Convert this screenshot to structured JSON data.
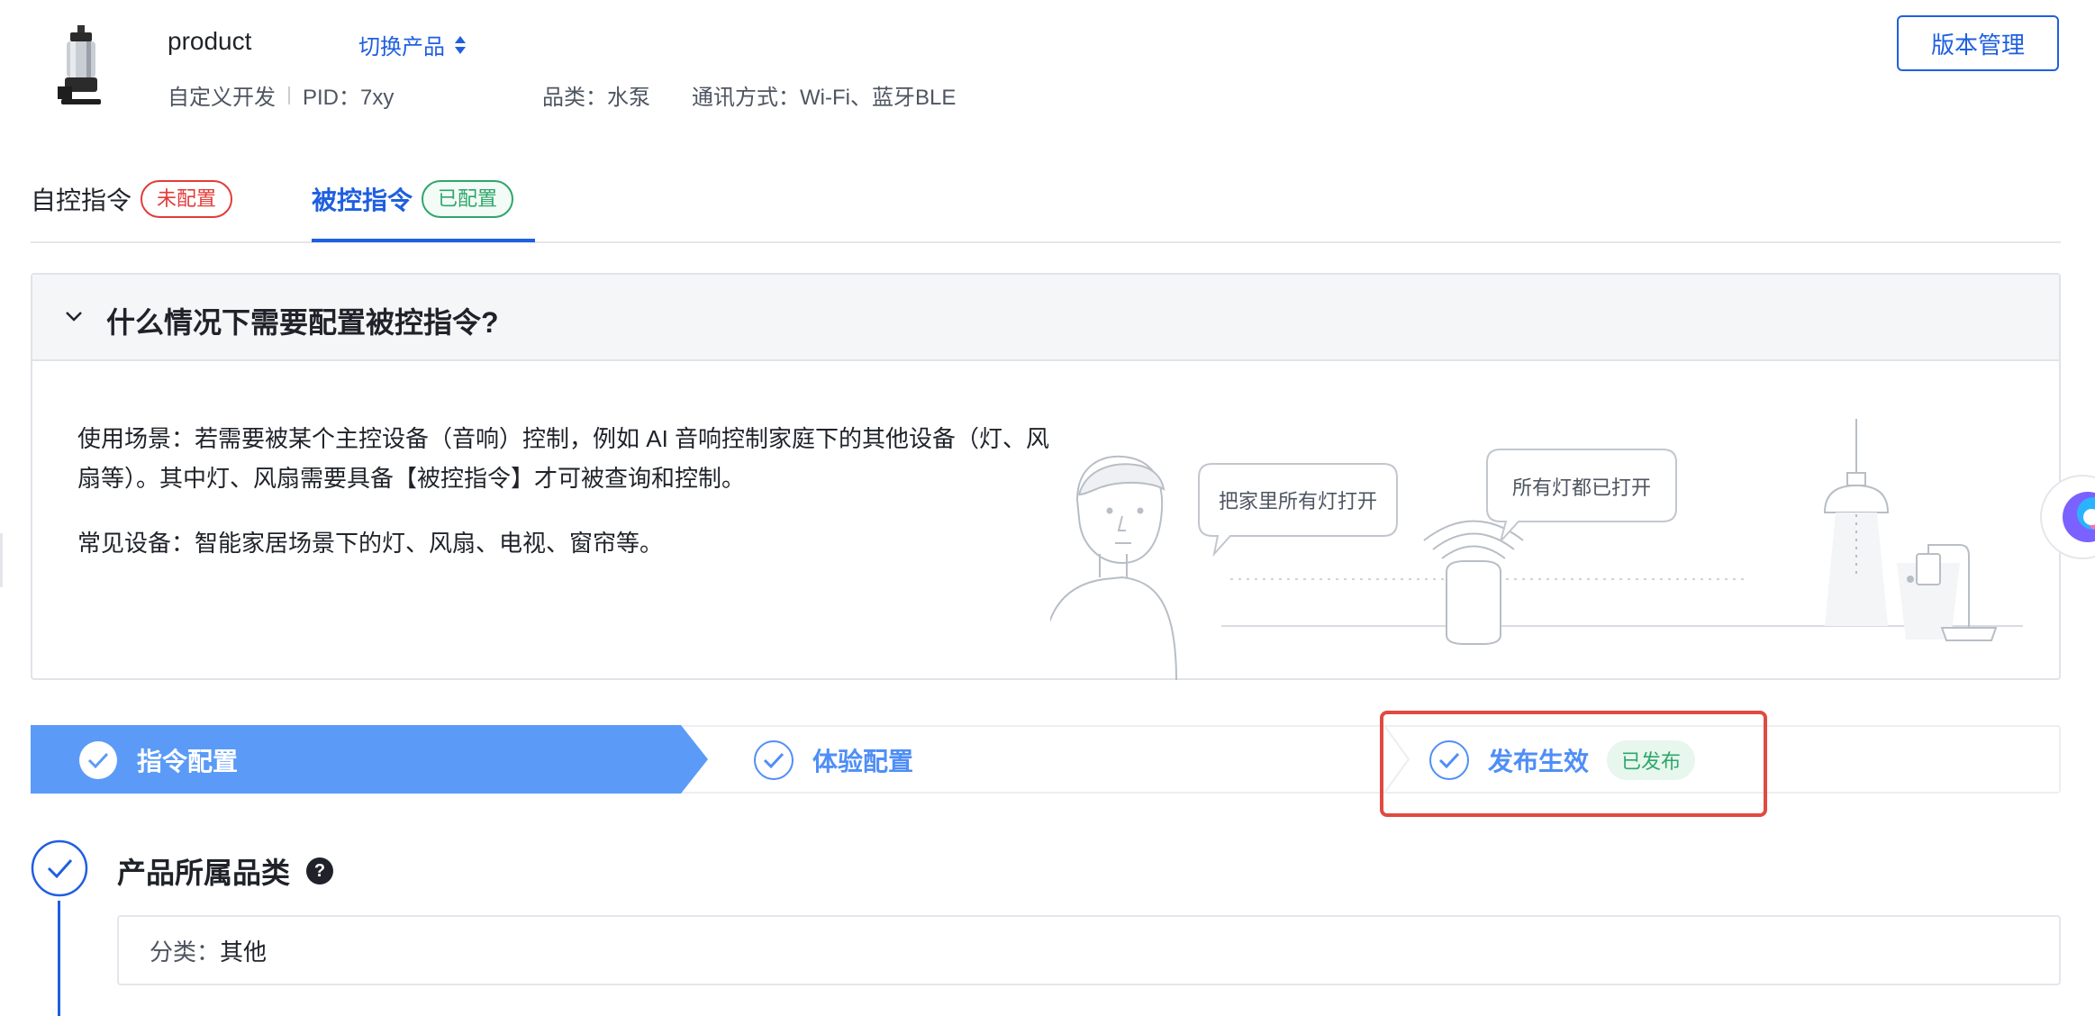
{
  "header": {
    "product_name": "product",
    "switch_label": "切换产品",
    "dev_type": "自定义开发",
    "pid_label": "PID：7xy",
    "category": "品类：水泵",
    "protocol": "通讯方式：Wi-Fi、蓝牙BLE",
    "version_button": "版本管理"
  },
  "tabs": [
    {
      "label": "自控指令",
      "badge": "未配置",
      "active": false
    },
    {
      "label": "被控指令",
      "badge": "已配置",
      "active": true
    }
  ],
  "panel": {
    "title": "什么情况下需要配置被控指令?",
    "scenario": "使用场景：若需要被某个主控设备（音响）控制，例如 AI 音响控制家庭下的其他设备（灯、风扇等）。其中灯、风扇需要具备【被控指令】才可被查询和控制。",
    "devices": "常见设备：智能家居场景下的灯、风扇、电视、窗帘等。",
    "bubble_left": "把家里所有灯打开",
    "bubble_right": "所有灯都已打开"
  },
  "steps": [
    {
      "label": "指令配置",
      "active": true
    },
    {
      "label": "体验配置",
      "active": false
    },
    {
      "label": "发布生效",
      "active": false,
      "badge": "已发布"
    }
  ],
  "section": {
    "title": "产品所属品类",
    "help": "?",
    "field_label": "分类：",
    "field_value": "其他"
  },
  "colors": {
    "primary": "#1f5fe0",
    "step_active": "#5b9bf7",
    "danger": "#e23c39",
    "success": "#2fa56b",
    "highlight": "#e14a41"
  }
}
